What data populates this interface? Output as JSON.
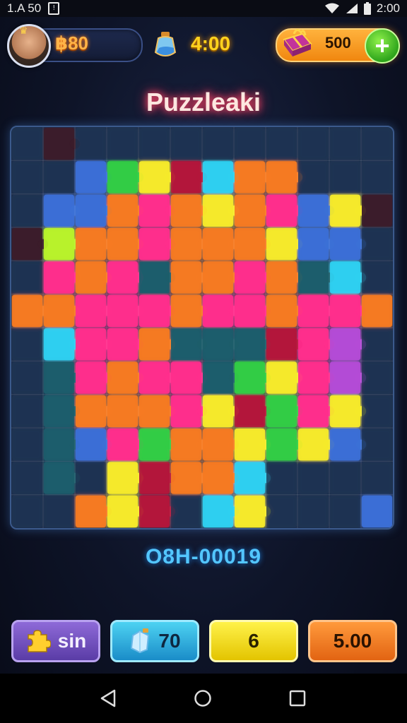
{
  "status_bar": {
    "left_text": "1.A 50",
    "notif_glyph": "!",
    "time": "2:00",
    "icons": [
      "wifi-icon",
      "signal-icon",
      "battery-icon"
    ]
  },
  "hud": {
    "coins": "฿80",
    "timer": "4:00",
    "gems": "500",
    "plus_label": "+"
  },
  "title": "Puzzleaki",
  "level_code": "O8H-00019",
  "buttons": [
    {
      "label": "sin",
      "icon": "puzzle-piece-icon",
      "color": "#7a56c4"
    },
    {
      "label": "70",
      "icon": "crystal-jar-icon",
      "color": "#33b5e5"
    },
    {
      "label": "6",
      "icon": "",
      "color": "#f7e21a"
    },
    {
      "label": "5.00",
      "icon": "",
      "color": "#f57a22"
    }
  ],
  "colors": {
    "background": "#0e1428",
    "accent_pink": "#ff2d8c",
    "accent_orange": "#ff7a1a",
    "board_border": "#3b5a8c"
  },
  "board": {
    "cols": 12,
    "rows": 12,
    "grid": [
      "NDNNNNNNNNNN",
      "NNBGYRCOONNN",
      "NBBOPOYOPBYD",
      "DLOOPOOOYBBN",
      "NPOPTOOPOTCN",
      "OOPPPOPPOPPO",
      "NCPPOTTTRPVN",
      "NTPOPPTGYPVN",
      "NTOOOPYRGPYN",
      "NTBPGOOYGYBN",
      "NTNYROOCNNNN",
      "NNOYRNCYNNNB"
    ],
    "palette": {
      "N": "#1f3352",
      "D": "#3a1a2a",
      "B": "#3b6fd6",
      "G": "#33cc44",
      "Y": "#f5ea2a",
      "R": "#b3163a",
      "C": "#2fd0f0",
      "O": "#f57a22",
      "P": "#ff2d8c",
      "L": "#b8f22a",
      "T": "#1b5d6b",
      "V": "#b44cd6"
    }
  }
}
